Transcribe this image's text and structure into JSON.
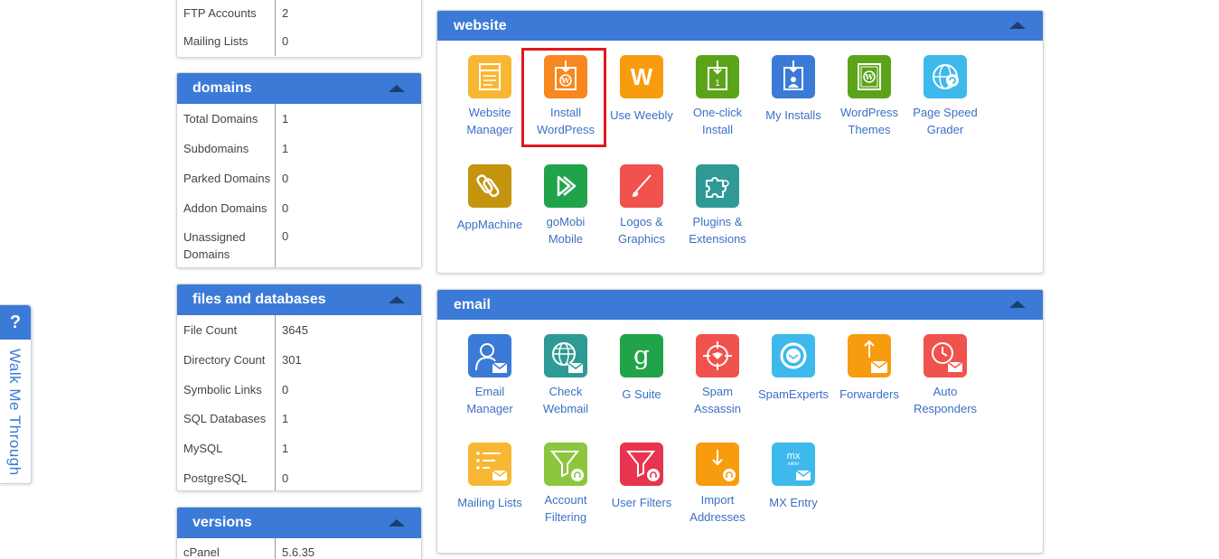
{
  "walk_me": {
    "badge": "?",
    "label": "Walk Me Through"
  },
  "left_boxes": [
    {
      "title": "",
      "rows": [
        {
          "label": "FTP Accounts",
          "value": "2"
        },
        {
          "label": "Mailing Lists",
          "value": "0"
        }
      ]
    },
    {
      "title": "domains",
      "rows": [
        {
          "label": "Total Domains",
          "value": "1"
        },
        {
          "label": "Subdomains",
          "value": "1"
        },
        {
          "label": "Parked Domains",
          "value": "0"
        },
        {
          "label": "Addon Domains",
          "value": "0"
        },
        {
          "label": "Unassigned Domains",
          "value": "0"
        }
      ]
    },
    {
      "title": "files and databases",
      "rows": [
        {
          "label": "File Count",
          "value": "3645"
        },
        {
          "label": "Directory Count",
          "value": "301"
        },
        {
          "label": "Symbolic Links",
          "value": "0"
        },
        {
          "label": "SQL Databases",
          "value": "1"
        },
        {
          "label": "MySQL",
          "value": "1"
        },
        {
          "label": "PostgreSQL",
          "value": "0"
        }
      ]
    },
    {
      "title": "versions",
      "rows": [
        {
          "label": "cPanel",
          "value": "5.6.35"
        }
      ]
    }
  ],
  "website_panel": {
    "title": "website",
    "tiles": [
      {
        "label": "Website Manager",
        "icon": "website-manager-icon",
        "color": "#f8b733"
      },
      {
        "label": "Install WordPress",
        "icon": "install-wordpress-icon",
        "color": "#f7871f"
      },
      {
        "label": "Use Weebly",
        "icon": "weebly-icon",
        "color": "#f79c0f"
      },
      {
        "label": "One-click Install",
        "icon": "one-click-install-icon",
        "color": "#5ba318"
      },
      {
        "label": "My Installs",
        "icon": "my-installs-icon",
        "color": "#3b7ad7"
      },
      {
        "label": "WordPress Themes",
        "icon": "wordpress-themes-icon",
        "color": "#5ba318"
      },
      {
        "label": "Page Speed Grader",
        "icon": "page-speed-icon",
        "color": "#3db9ec"
      },
      {
        "label": "AppMachine",
        "icon": "appmachine-icon",
        "color": "#c4940f"
      },
      {
        "label": "goMobi Mobile",
        "icon": "gomobi-icon",
        "color": "#21a34a"
      },
      {
        "label": "Logos & Graphics",
        "icon": "logos-graphics-icon",
        "color": "#f0524e"
      },
      {
        "label": "Plugins & Extensions",
        "icon": "plugins-icon",
        "color": "#2f9a95"
      }
    ]
  },
  "email_panel": {
    "title": "email",
    "tiles": [
      {
        "label": "Email Manager",
        "icon": "email-manager-icon",
        "color": "#3b7ad7"
      },
      {
        "label": "Check Webmail",
        "icon": "webmail-icon",
        "color": "#2f9a95"
      },
      {
        "label": "G Suite",
        "icon": "g-suite-icon",
        "color": "#21a34a"
      },
      {
        "label": "Spam Assassin",
        "icon": "spam-assassin-icon",
        "color": "#f0524e"
      },
      {
        "label": "SpamExperts",
        "icon": "spamexperts-icon",
        "color": "#3db9ec"
      },
      {
        "label": "Forwarders",
        "icon": "forwarders-icon",
        "color": "#f79c0f"
      },
      {
        "label": "Auto Responders",
        "icon": "auto-responders-icon",
        "color": "#f0524e"
      },
      {
        "label": "Mailing Lists",
        "icon": "mailing-lists-icon",
        "color": "#f8b733"
      },
      {
        "label": "Account Filtering",
        "icon": "account-filtering-icon",
        "color": "#8cc63f"
      },
      {
        "label": "User Filters",
        "icon": "user-filters-icon",
        "color": "#e8344e"
      },
      {
        "label": "Import Addresses",
        "icon": "import-addresses-icon",
        "color": "#f79c0f"
      },
      {
        "label": "MX Entry",
        "icon": "mx-entry-icon",
        "color": "#3db9ec",
        "icon_text": "mx",
        "icon_subtext": "editor"
      }
    ]
  },
  "icon_glyphs": {
    "weebly": "W",
    "gsuite": "g"
  }
}
